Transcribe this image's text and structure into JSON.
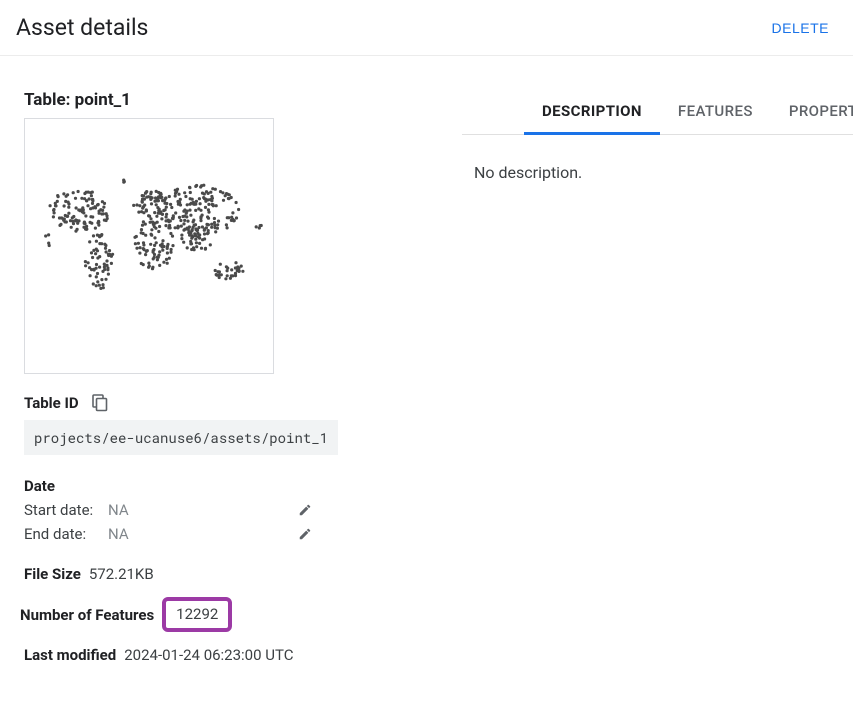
{
  "header": {
    "title": "Asset details",
    "delete_label": "DELETE"
  },
  "left": {
    "table_title": "Table: point_1",
    "table_id_label": "Table ID",
    "table_id_value": "projects/ee-ucanuse6/assets/point_1",
    "date_label": "Date",
    "start_date_label": "Start date:",
    "start_date_value": "NA",
    "end_date_label": "End date:",
    "end_date_value": "NA",
    "file_size_label": "File Size",
    "file_size_value": "572.21KB",
    "num_features_label": "Number of Features",
    "num_features_value": "12292",
    "last_modified_label": "Last modified",
    "last_modified_value": "2024-01-24 06:23:00 UTC",
    "highlight_color": "#9c3aa5"
  },
  "tabs": {
    "items": [
      {
        "label": "DESCRIPTION",
        "active": true
      },
      {
        "label": "FEATURES",
        "active": false
      },
      {
        "label": "PROPERTIES",
        "active": false
      }
    ],
    "description_body": "No description."
  }
}
